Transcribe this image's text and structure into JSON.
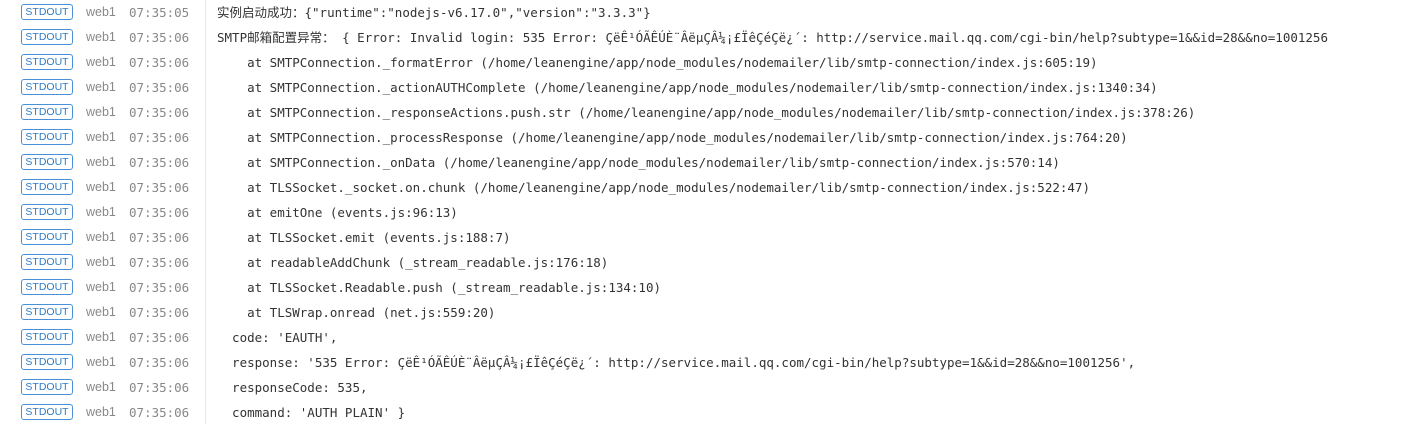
{
  "badge_label": "STDOUT",
  "instance": "web1",
  "rows": [
    {
      "time": "07:35:05",
      "text": "实例启动成功：{\"runtime\":\"nodejs-v6.17.0\",\"version\":\"3.3.3\"}"
    },
    {
      "time": "07:35:06",
      "text": "SMTP邮箱配置异常： { Error: Invalid login: 535 Error: ÇëÊ¹ÓÃÊÚÈ¨ÂëµÇÂ¼¡£ÏêÇéÇë¿´: http://service.mail.qq.com/cgi-bin/help?subtype=1&&id=28&&no=1001256"
    },
    {
      "time": "07:35:06",
      "text": "    at SMTPConnection._formatError (/home/leanengine/app/node_modules/nodemailer/lib/smtp-connection/index.js:605:19)"
    },
    {
      "time": "07:35:06",
      "text": "    at SMTPConnection._actionAUTHComplete (/home/leanengine/app/node_modules/nodemailer/lib/smtp-connection/index.js:1340:34)"
    },
    {
      "time": "07:35:06",
      "text": "    at SMTPConnection._responseActions.push.str (/home/leanengine/app/node_modules/nodemailer/lib/smtp-connection/index.js:378:26)"
    },
    {
      "time": "07:35:06",
      "text": "    at SMTPConnection._processResponse (/home/leanengine/app/node_modules/nodemailer/lib/smtp-connection/index.js:764:20)"
    },
    {
      "time": "07:35:06",
      "text": "    at SMTPConnection._onData (/home/leanengine/app/node_modules/nodemailer/lib/smtp-connection/index.js:570:14)"
    },
    {
      "time": "07:35:06",
      "text": "    at TLSSocket._socket.on.chunk (/home/leanengine/app/node_modules/nodemailer/lib/smtp-connection/index.js:522:47)"
    },
    {
      "time": "07:35:06",
      "text": "    at emitOne (events.js:96:13)"
    },
    {
      "time": "07:35:06",
      "text": "    at TLSSocket.emit (events.js:188:7)"
    },
    {
      "time": "07:35:06",
      "text": "    at readableAddChunk (_stream_readable.js:176:18)"
    },
    {
      "time": "07:35:06",
      "text": "    at TLSSocket.Readable.push (_stream_readable.js:134:10)"
    },
    {
      "time": "07:35:06",
      "text": "    at TLSWrap.onread (net.js:559:20)"
    },
    {
      "time": "07:35:06",
      "text": "  code: 'EAUTH',"
    },
    {
      "time": "07:35:06",
      "text": "  response: '535 Error: ÇëÊ¹ÓÃÊÚÈ¨ÂëµÇÂ¼¡£ÏêÇéÇë¿´: http://service.mail.qq.com/cgi-bin/help?subtype=1&&id=28&&no=1001256',"
    },
    {
      "time": "07:35:06",
      "text": "  responseCode: 535,"
    },
    {
      "time": "07:35:06",
      "text": "  command: 'AUTH PLAIN' }"
    }
  ]
}
